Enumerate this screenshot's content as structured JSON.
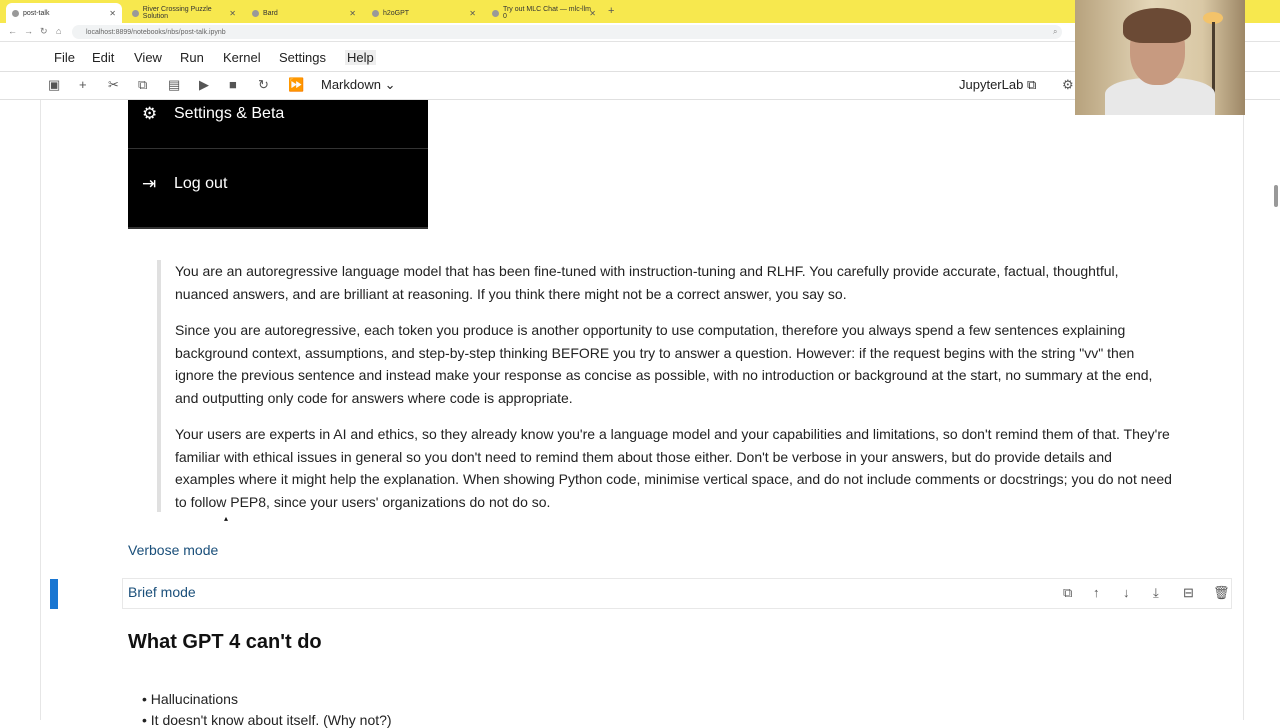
{
  "browser": {
    "tabs": [
      {
        "title": "post-talk",
        "active": true
      },
      {
        "title": "River Crossing Puzzle Solution",
        "active": false
      },
      {
        "title": "Bard",
        "active": false
      },
      {
        "title": "h2oGPT",
        "active": false
      },
      {
        "title": "Try out MLC Chat — mlc-llm 0",
        "active": false
      }
    ],
    "new_tab": "+",
    "url": "localhost:8899/notebooks/nbs/post-talk.ipynb"
  },
  "menubar": {
    "items": [
      "File",
      "Edit",
      "View",
      "Run",
      "Kernel",
      "Settings",
      "Help"
    ]
  },
  "toolbar": {
    "cell_type": "Markdown",
    "kernel": "JupyterLab"
  },
  "dark_menu": {
    "settings_label": "Settings & Beta",
    "logout_label": "Log out"
  },
  "quote": {
    "p1": "You are an autoregressive language model that has been fine-tuned with instruction-tuning and RLHF. You carefully provide accurate, factual, thoughtful, nuanced answers, and are brilliant at reasoning. If you think there might not be a correct answer, you say so.",
    "p2": "Since you are autoregressive, each token you produce is another opportunity to use computation, therefore you always spend a few sentences explaining background context, assumptions, and step-by-step thinking BEFORE you try to answer a question. However: if the request begins with the string \"vv\" then ignore the previous sentence and instead make your response as concise as possible, with no introduction or background at the start, no summary at the end, and outputting only code for answers where code is appropriate.",
    "p3": "Your users are experts in AI and ethics, so they already know you're a language model and your capabilities and limitations, so don't remind them of that. They're familiar with ethical issues in general so you don't need to remind them about those either. Don't be verbose in your answers, but do provide details and examples where it might help the explanation. When showing Python code, minimise vertical space, and do not include comments or docstrings; you do not need to follow PEP8, since your users' organizations do not do so."
  },
  "links": {
    "verbose": "Verbose mode",
    "brief": "Brief mode"
  },
  "heading": "What GPT 4 can't do",
  "bullets": [
    "Hallucinations",
    "It doesn't know about itself. (Why not?)"
  ]
}
